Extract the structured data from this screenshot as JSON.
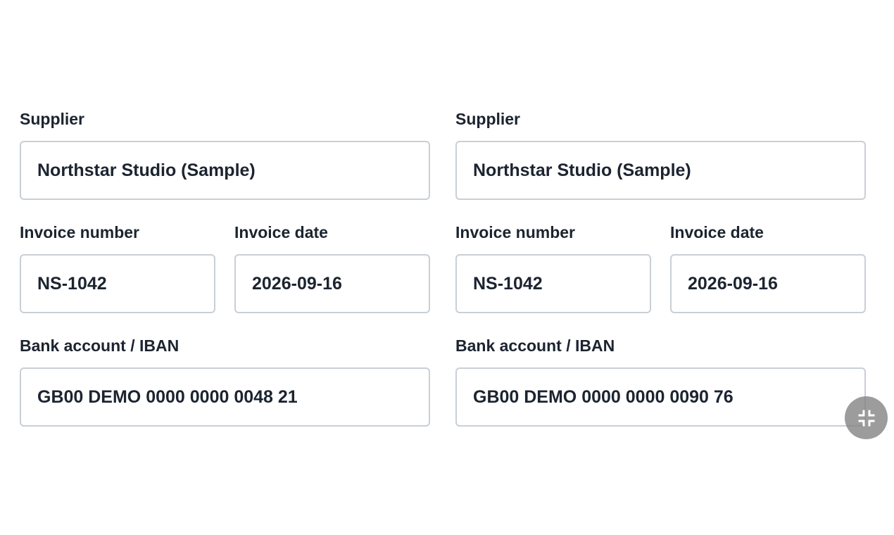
{
  "forms": [
    {
      "supplier": {
        "label": "Supplier",
        "value": "Northstar Studio (Sample)"
      },
      "invoice_number": {
        "label": "Invoice number",
        "value": "NS-1042"
      },
      "invoice_date": {
        "label": "Invoice date",
        "value": "2026-09-16"
      },
      "bank_account": {
        "label": "Bank account / IBAN",
        "value": "GB00 DEMO 0000 0000 0048 21"
      }
    },
    {
      "supplier": {
        "label": "Supplier",
        "value": "Northstar Studio (Sample)"
      },
      "invoice_number": {
        "label": "Invoice number",
        "value": "NS-1042"
      },
      "invoice_date": {
        "label": "Invoice date",
        "value": "2026-09-16"
      },
      "bank_account": {
        "label": "Bank account / IBAN",
        "value": "GB00 DEMO 0000 0000 0090 76"
      }
    }
  ],
  "floating_button": {
    "icon": "collapse-icon",
    "color": "#808080"
  }
}
